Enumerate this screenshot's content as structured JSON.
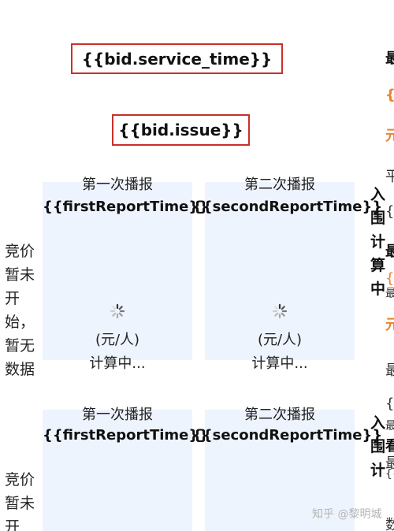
{
  "templates": {
    "service_time": "{{bid.service_time}}",
    "issue": "{{bid.issue}}"
  },
  "panels": [
    {
      "title": "第一次播报",
      "var": "{{firstReportTime}}",
      "unit": "(元/人)",
      "status": "计算中..."
    },
    {
      "title": "第二次播报",
      "var": "{{secondReportTime}}",
      "unit": "(元/人)",
      "status": "计算中..."
    }
  ],
  "panels2": [
    {
      "title": "第一次播报",
      "var": "{{firstReportTime}}"
    },
    {
      "title": "第二次播报",
      "var": "{{secondReportTime}}"
    }
  ],
  "left_status": {
    "block1": [
      "竞价",
      "暂未",
      "开",
      "始，",
      "暂无",
      "数据"
    ],
    "block2": [
      "竞价",
      "暂未",
      "开"
    ]
  },
  "vertical_labels": {
    "col1": [
      "入",
      "围",
      "计",
      "算",
      "中"
    ],
    "col2": [
      "入",
      "围",
      "计"
    ]
  },
  "right_edge": {
    "r1": "最",
    "r2": "{{",
    "r3": "元",
    "r4": "平",
    "r5": "{{",
    "r6": "最",
    "r7": "{{",
    "r8": "最",
    "r9": "元",
    "r10": "最",
    "r11": "{{",
    "r12": "最",
    "r13": "看",
    "r14": "最",
    "r15": "{{",
    "r16": "数"
  },
  "colors": {
    "accent_orange": "#e8842a",
    "box_border": "#c9302c",
    "panel_bg": "#eef4fd"
  },
  "watermark": "知乎 @黎明城"
}
